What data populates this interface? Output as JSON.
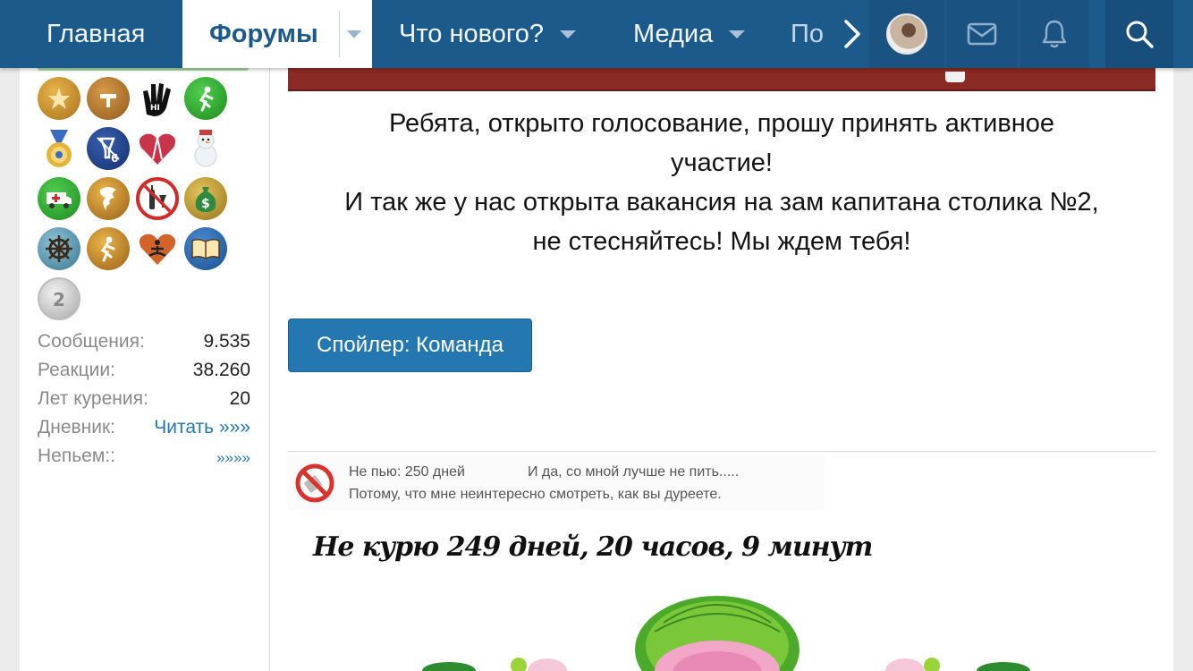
{
  "nav": {
    "home": "Главная",
    "forums": "Форумы",
    "whats_new": "Что нового?",
    "media": "Медиа",
    "more_cut": "По"
  },
  "sidebar": {
    "badges": [
      {
        "icon": "stars-trophy-icon",
        "color": "#c08a2a"
      },
      {
        "icon": "hammer-stars-icon",
        "color": "#b5772a"
      },
      {
        "icon": "hi-hand-icon",
        "color": "#111111"
      },
      {
        "icon": "runner-green-icon",
        "color": "#2ea62e"
      },
      {
        "icon": "medal-icon",
        "color": "#e0b43c"
      },
      {
        "icon": "glass-six-icon",
        "color": "#1d3f8a"
      },
      {
        "icon": "heart-tower-icon",
        "color": "#c0354a"
      },
      {
        "icon": "snowman-icon",
        "color": "#dfe7ee"
      },
      {
        "icon": "ambulance-icon",
        "color": "#2ea62e"
      },
      {
        "icon": "storm-icon",
        "color": "#c08a2a"
      },
      {
        "icon": "no-alcohol-icon",
        "color": "#d02a2a"
      },
      {
        "icon": "money-bag-icon",
        "color": "#c8a23a"
      },
      {
        "icon": "ship-wheel-icon",
        "color": "#5a8fa8"
      },
      {
        "icon": "runner-gold-icon",
        "color": "#c08a2a"
      },
      {
        "icon": "meditation-heart-icon",
        "color": "#c0542a"
      },
      {
        "icon": "book-icon",
        "color": "#2266aa"
      },
      {
        "icon": "silver-coin-icon",
        "color": "#c9c9c9"
      }
    ],
    "stats": [
      {
        "label": "Сообщения:",
        "value": "9.535"
      },
      {
        "label": "Реакции:",
        "value": "38.260"
      },
      {
        "label": "Лет курения:",
        "value": "20"
      },
      {
        "label": "Дневник:",
        "value": "Читать »»»"
      },
      {
        "label": "Непьем::",
        "value": "»»»»"
      }
    ]
  },
  "post": {
    "line1": "Ребята, открыто голосование, прошу принять активное",
    "line2": "участие!",
    "line3": "И так же у нас открыта вакансия на зам капитана столика №2,",
    "line4": "не стесняйтесь! Мы ждем тебя!",
    "spoiler": "Спойлер: Команда"
  },
  "signature": {
    "no_drink": "Не пью: 250 дней",
    "better": "И да, со мной лучше не пить.....",
    "reason": "Потому, что мне неинтересно смотреть, как вы дуреете.",
    "no_smoke": "Не курю  249 дней, 20 часов, 9 минут"
  },
  "colors": {
    "nav_bg": "#1d5a8c",
    "link": "#2577b1",
    "button": "#2577b1"
  }
}
